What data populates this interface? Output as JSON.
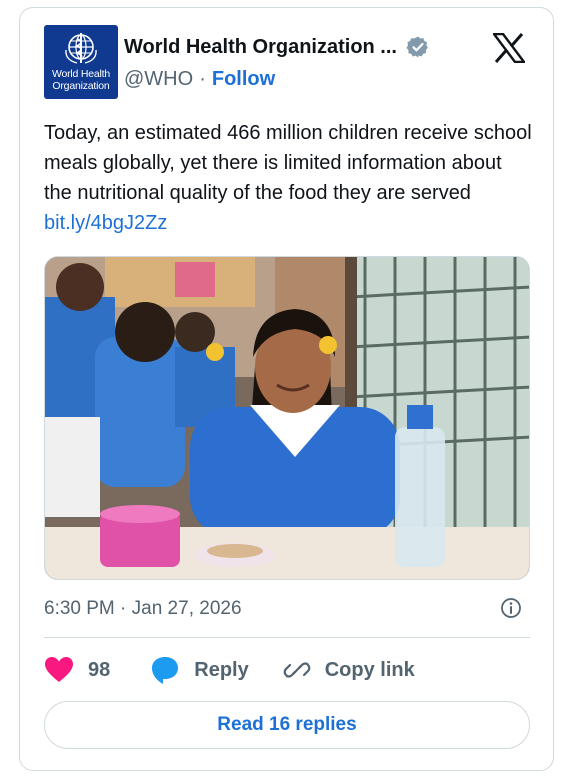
{
  "colors": {
    "link": "#1d71d6",
    "secondary_text": "#536471",
    "like": "#f91880",
    "reply_bubble": "#1d9bf0",
    "avatar_bg": "#0f3a8f",
    "border": "#cfd9de"
  },
  "author": {
    "avatar_text_line1": "World Health",
    "avatar_text_line2": "Organization",
    "display_name": "World Health Organization ...",
    "verified_icon": "verified-badge-icon",
    "handle": "@WHO",
    "separator": "·",
    "follow_label": "Follow"
  },
  "platform_icon": "x-logo-icon",
  "tweet": {
    "text": "Today, an estimated 466 million children receive school meals globally, yet there is limited information about the nutritional quality of the food they are served ",
    "link_text": "bit.ly/4bgJ2Zz"
  },
  "media": {
    "icon": "photo",
    "alt": "Schoolgirl in blue uniform smiling at a table with a pink lunch box, a plate of food and a water bottle"
  },
  "footer": {
    "timestamp": "6:30 PM · Jan 27, 2026",
    "info_icon": "info-icon"
  },
  "actions": {
    "like_count": "98",
    "reply_label": "Reply",
    "copy_link_label": "Copy link"
  },
  "read_replies_label": "Read 16 replies"
}
